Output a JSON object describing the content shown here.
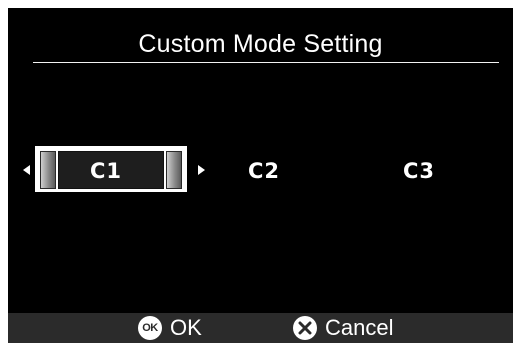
{
  "header": {
    "title": "Custom Mode Setting"
  },
  "modes": {
    "selected": "C1",
    "items": [
      "C1",
      "C2",
      "C3"
    ]
  },
  "footer": {
    "ok_icon_text": "OK",
    "ok_label": "OK",
    "cancel_label": "Cancel"
  },
  "colors": {
    "background": "#000000",
    "text": "#ffffff",
    "footer_bar": "#2b2b2b"
  },
  "icons": {
    "ok": "ok-button-icon",
    "cancel": "x-circle-icon",
    "left": "triangle-left-icon",
    "right": "triangle-right-icon"
  }
}
